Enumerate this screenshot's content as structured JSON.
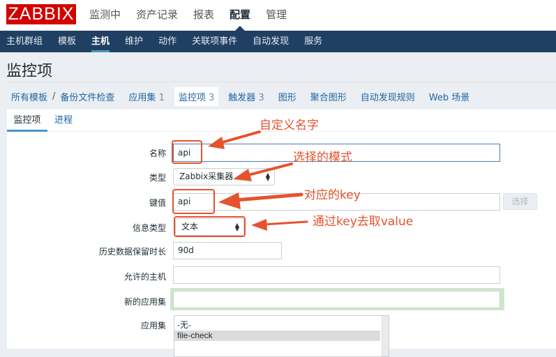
{
  "brand": {
    "logo_text": "ZABBIX",
    "accent_color": "#d40000"
  },
  "top_menu": [
    {
      "label": "监测中"
    },
    {
      "label": "资产记录"
    },
    {
      "label": "报表"
    },
    {
      "label": "配置",
      "active": true
    },
    {
      "label": "管理"
    }
  ],
  "sub_menu": [
    {
      "label": "主机群组"
    },
    {
      "label": "模板"
    },
    {
      "label": "主机",
      "active": true
    },
    {
      "label": "维护"
    },
    {
      "label": "动作"
    },
    {
      "label": "关联项事件"
    },
    {
      "label": "自动发现"
    },
    {
      "label": "服务"
    }
  ],
  "page": {
    "title": "监控项"
  },
  "breadcrumbs": {
    "all_templates": "所有模板",
    "separator": "/",
    "template": "备份文件检查",
    "links": [
      {
        "label": "应用集",
        "count": "1"
      },
      {
        "label": "监控项",
        "count": "3",
        "active": true
      },
      {
        "label": "触发器",
        "count": "3"
      },
      {
        "label": "图形",
        "count": ""
      },
      {
        "label": "聚合图形",
        "count": ""
      },
      {
        "label": "自动发现规则",
        "count": ""
      },
      {
        "label": "Web 场景",
        "count": ""
      }
    ]
  },
  "tabs": [
    {
      "label": "监控项",
      "active": true
    },
    {
      "label": "进程"
    }
  ],
  "form": {
    "name": {
      "label": "名称",
      "value": "api"
    },
    "type": {
      "label": "类型",
      "value": "Zabbix采集器"
    },
    "key": {
      "label": "键值",
      "value": "api",
      "button": "选择"
    },
    "info_type": {
      "label": "信息类型",
      "value": "文本"
    },
    "history": {
      "label": "历史数据保留时长",
      "value": "90d"
    },
    "allowed_hosts": {
      "label": "允许的主机",
      "value": ""
    },
    "new_application": {
      "label": "新的应用集",
      "value": ""
    },
    "applications": {
      "label": "应用集",
      "options": [
        "-无-",
        "file-check"
      ],
      "selected": "file-check"
    }
  },
  "annotations": {
    "color": "#e5532d",
    "name_note": "自定义名字",
    "type_note": "选择的模式",
    "key_note": "对应的key",
    "info_note": "通过key去取value"
  }
}
